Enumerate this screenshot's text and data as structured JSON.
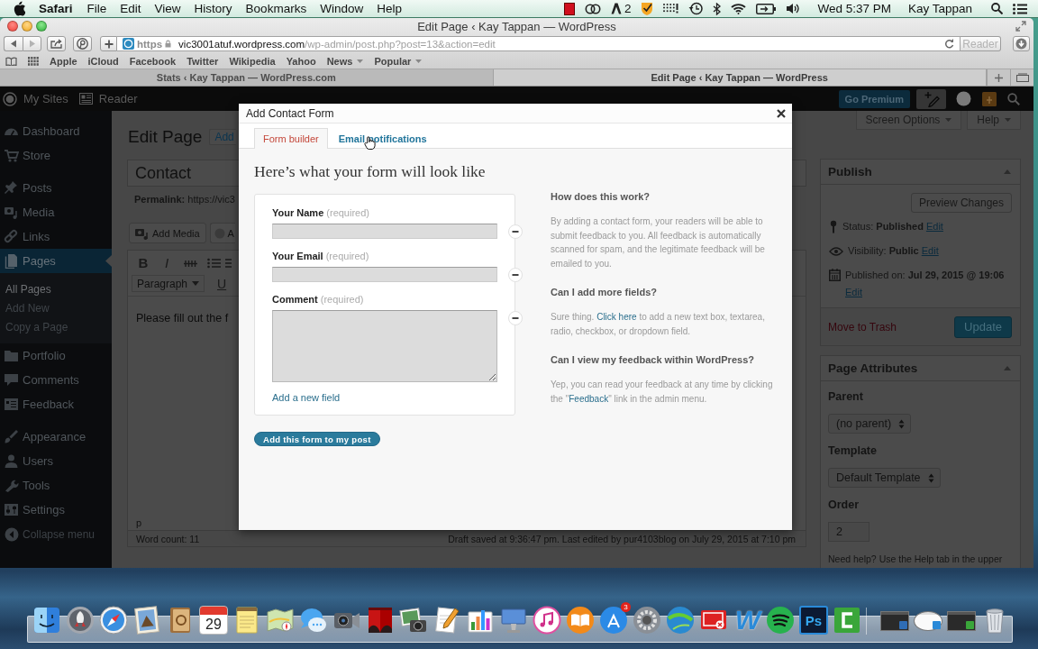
{
  "menu_bar": {
    "app": "Safari",
    "menus": [
      "File",
      "Edit",
      "View",
      "History",
      "Bookmarks",
      "Window",
      "Help"
    ],
    "badge_count": "2",
    "clock": "Wed 5:37 PM",
    "user": "Kay Tappan"
  },
  "browser": {
    "title": "Edit Page ‹ Kay Tappan — WordPress",
    "url": {
      "scheme": "https",
      "host": "vic3001atuf.wordpress.com",
      "path": "/wp-admin/post.php?post=13&action=edit"
    },
    "reader_button": "Reader",
    "bookmarks": [
      {
        "label": "Apple",
        "kind": "link"
      },
      {
        "label": "iCloud",
        "kind": "link"
      },
      {
        "label": "Facebook",
        "kind": "link"
      },
      {
        "label": "Twitter",
        "kind": "link"
      },
      {
        "label": "Wikipedia",
        "kind": "link"
      },
      {
        "label": "Yahoo",
        "kind": "link"
      },
      {
        "label": "News",
        "kind": "folder"
      },
      {
        "label": "Popular",
        "kind": "folder"
      }
    ],
    "tabs": [
      {
        "label": "Stats ‹ Kay Tappan — WordPress.com",
        "selected": false
      },
      {
        "label": "Edit Page ‹ Kay Tappan — WordPress",
        "selected": true
      }
    ]
  },
  "admin_bar": {
    "my_sites": "My Sites",
    "reader": "Reader",
    "premium_button": "Go Premium"
  },
  "sidebar": {
    "sections": [
      {
        "items": [
          {
            "label": "Dashboard",
            "selected": false
          },
          {
            "label": "Store",
            "selected": false
          }
        ]
      },
      {
        "items": [
          {
            "label": "Posts",
            "selected": false
          },
          {
            "label": "Media",
            "selected": false
          },
          {
            "label": "Links",
            "selected": false
          },
          {
            "label": "Pages",
            "selected": true,
            "children": [
              {
                "label": "All Pages",
                "selected": true
              },
              {
                "label": "Add New",
                "selected": false
              },
              {
                "label": "Copy a Page",
                "selected": false
              }
            ]
          },
          {
            "label": "Portfolio",
            "selected": false
          },
          {
            "label": "Comments",
            "selected": false
          },
          {
            "label": "Feedback",
            "selected": false
          }
        ]
      },
      {
        "items": [
          {
            "label": "Appearance",
            "selected": false
          },
          {
            "label": "Users",
            "selected": false
          },
          {
            "label": "Tools",
            "selected": false
          },
          {
            "label": "Settings",
            "selected": false
          }
        ]
      }
    ],
    "collapse": "Collapse menu"
  },
  "screen_meta": [
    "Screen Options",
    "Help"
  ],
  "editor": {
    "heading": "Edit Page",
    "add_new": "Add",
    "title": "Contact",
    "permalink_label": "Permalink:",
    "permalink": "https://vic3",
    "media_buttons": [
      "Add Media",
      "A"
    ],
    "format_buttons": [
      "B",
      "I"
    ],
    "format_select": "Paragraph",
    "underline_button": "U",
    "content": "Please fill out the f",
    "path": "p",
    "word_count": "Word count: 11",
    "draft_status": "Draft saved at 9:36:47 pm. Last edited by pur4103blog on July 29, 2015 at 7:10 pm"
  },
  "modal": {
    "title": "Add Contact Form",
    "tabs": [
      {
        "label": "Form builder",
        "selected": true
      },
      {
        "label": "Email notifications",
        "selected": false
      }
    ],
    "heading": "Here’s what your form will look like",
    "fields": [
      {
        "label": "Your Name",
        "note": "(required)",
        "kind": "text"
      },
      {
        "label": "Your Email",
        "note": "(required)",
        "kind": "text"
      },
      {
        "label": "Comment",
        "note": "(required)",
        "kind": "textarea"
      }
    ],
    "add_field_link": "Add a new field",
    "submit_button": "Add this form to my post",
    "help": [
      {
        "question": "How does this work?",
        "answer": {
          "text": "By adding a contact form, your readers will be able to submit feedback to you. All feedback is automatically scanned for spam, and the legitimate feedback will be emailed to you."
        }
      },
      {
        "question": "Can I add more fields?",
        "answer": {
          "text": "Sure thing. ",
          "link": "Click here",
          "after": " to add a new text box, textarea, radio, checkbox, or dropdown field."
        }
      },
      {
        "question": "Can I view my feedback within WordPress?",
        "answer": {
          "text": "Yep, you can read your feedback at any time by clicking the \"",
          "link": "Feedback",
          "after": "\" link in the admin menu."
        }
      }
    ]
  },
  "publish": {
    "title": "Publish",
    "preview_button": "Preview Changes",
    "rows": [
      {
        "label": "Status:",
        "value": "Published",
        "link": "Edit"
      },
      {
        "label": "Visibility:",
        "value": "Public",
        "link": "Edit"
      },
      {
        "label": "Published on:",
        "value": "Jul 29, 2015 @ 19:06",
        "link": "Edit"
      }
    ],
    "trash_link": "Move to Trash",
    "update_button": "Update"
  },
  "page_attributes": {
    "title": "Page Attributes",
    "fields": [
      {
        "label": "Parent",
        "value": "(no parent)",
        "kind": "select"
      },
      {
        "label": "Template",
        "value": "Default Template",
        "kind": "select"
      },
      {
        "label": "Order",
        "value": "2",
        "kind": "input"
      }
    ],
    "help_text": "Need help? Use the Help tab in the upper"
  },
  "dock": {
    "apps": [
      {
        "kind": "face"
      },
      {
        "kind": "rocket"
      },
      {
        "kind": "compass"
      },
      {
        "kind": "stamp"
      },
      {
        "kind": "address-book"
      },
      {
        "kind": "calendar",
        "text": "29"
      },
      {
        "kind": "notepad"
      },
      {
        "kind": "map"
      },
      {
        "kind": "chat"
      },
      {
        "kind": "camera"
      },
      {
        "kind": "curtain"
      },
      {
        "kind": "photo"
      },
      {
        "kind": "pencil"
      },
      {
        "kind": "chart"
      },
      {
        "kind": "podium"
      },
      {
        "kind": "music"
      },
      {
        "kind": "open-book"
      },
      {
        "kind": "app-store",
        "badge": "3"
      },
      {
        "kind": "gear"
      },
      {
        "kind": "globe"
      },
      {
        "kind": "remote"
      },
      {
        "kind": "letter",
        "text": "W"
      },
      {
        "kind": "waves"
      },
      {
        "kind": "letter-tile",
        "text": "Ps"
      },
      {
        "kind": "bracket"
      }
    ],
    "windows": [
      {
        "kind": "dark",
        "color": "#2f6db5"
      },
      {
        "kind": "light",
        "color": "#2a8ad8"
      },
      {
        "kind": "dark",
        "color": "#3aa63a"
      }
    ]
  }
}
